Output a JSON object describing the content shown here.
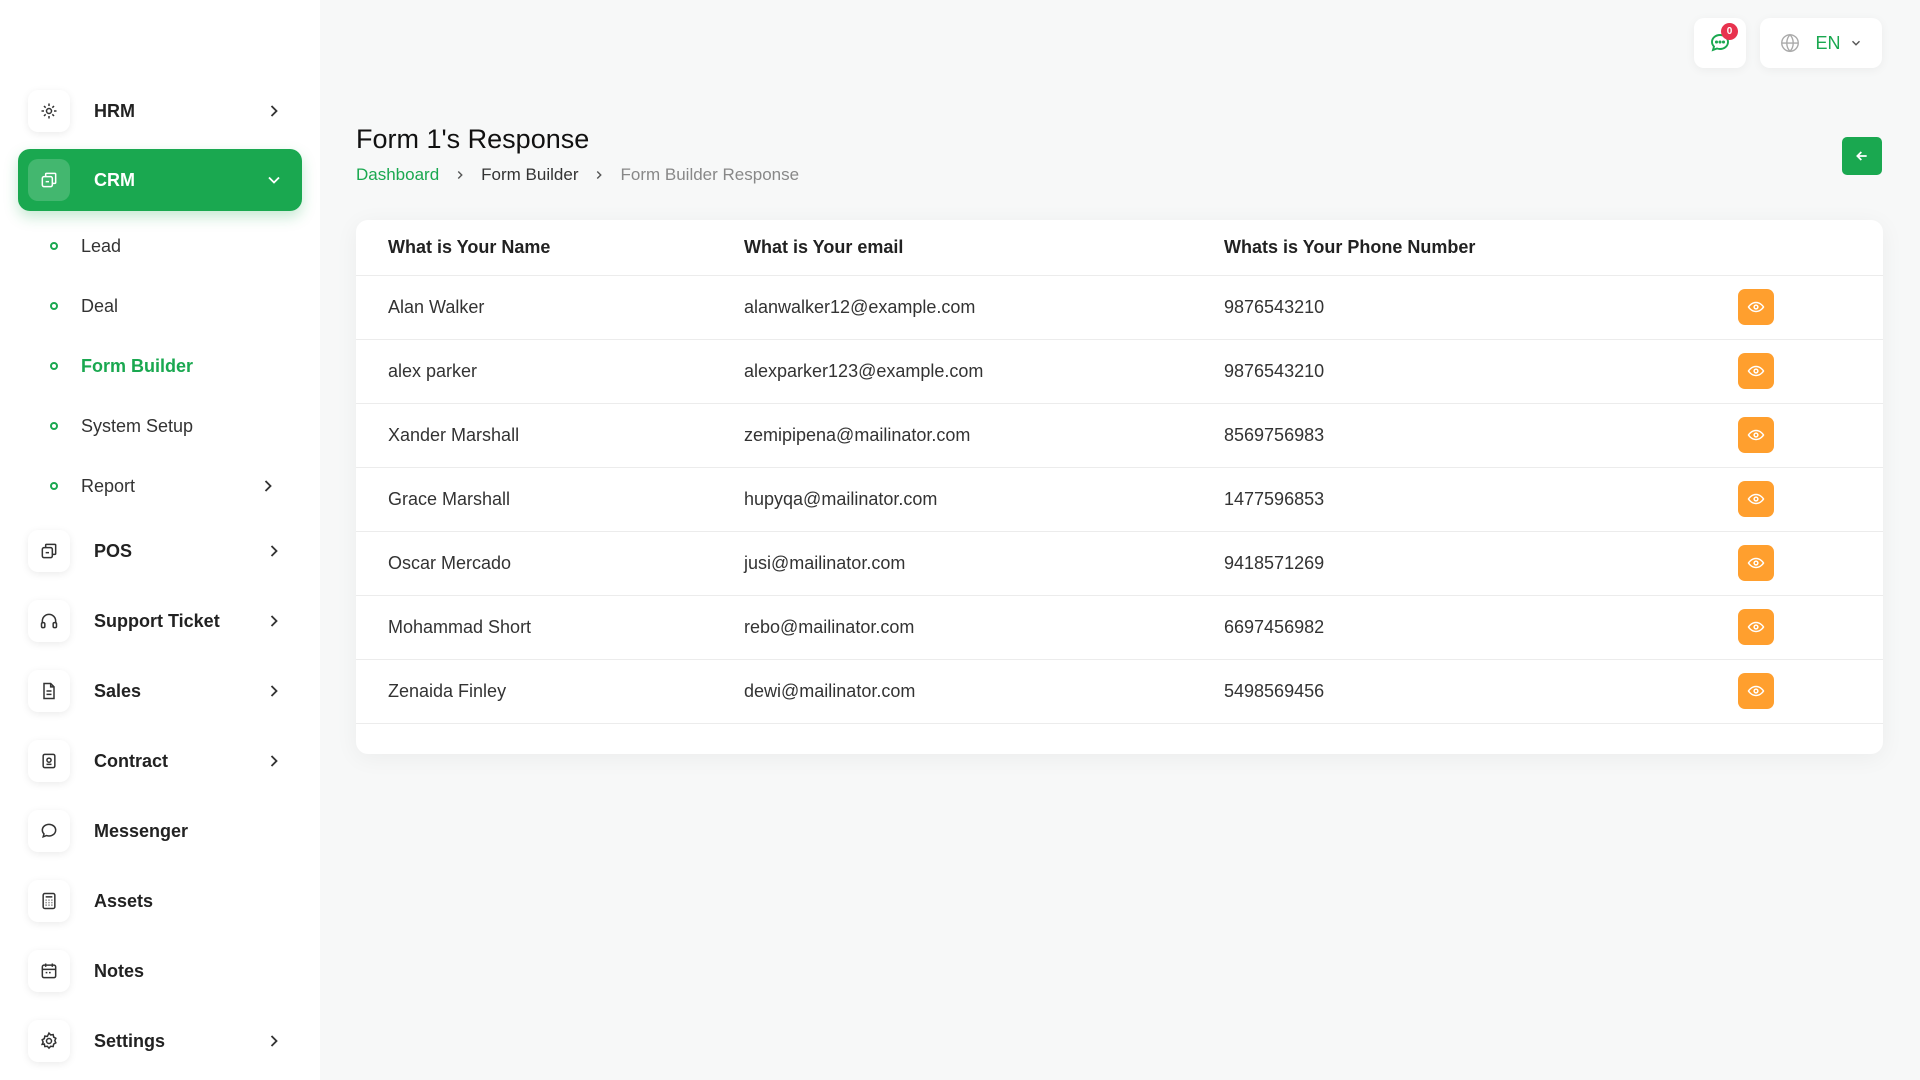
{
  "sidebar": {
    "items": [
      {
        "name": "hrm",
        "label": "HRM",
        "icon": "hrm-icon"
      },
      {
        "name": "crm",
        "label": "CRM",
        "icon": "crm-icon"
      },
      {
        "name": "pos",
        "label": "POS",
        "icon": "pos-icon"
      },
      {
        "name": "support-ticket",
        "label": "Support Ticket",
        "icon": "headset-icon"
      },
      {
        "name": "sales",
        "label": "Sales",
        "icon": "document-icon"
      },
      {
        "name": "contract",
        "label": "Contract",
        "icon": "contract-icon"
      },
      {
        "name": "messenger",
        "label": "Messenger",
        "icon": "chat-icon"
      },
      {
        "name": "assets",
        "label": "Assets",
        "icon": "calculator-icon"
      },
      {
        "name": "notes",
        "label": "Notes",
        "icon": "calendar-icon"
      },
      {
        "name": "settings",
        "label": "Settings",
        "icon": "gear-icon"
      }
    ],
    "crm_sub": [
      {
        "label": "Lead"
      },
      {
        "label": "Deal"
      },
      {
        "label": "Form Builder"
      },
      {
        "label": "System Setup"
      },
      {
        "label": "Report"
      }
    ]
  },
  "topbar": {
    "notification_count": "0",
    "language": "EN"
  },
  "page": {
    "title": "Form 1's Response",
    "breadcrumb": [
      "Dashboard",
      "Form Builder",
      "Form Builder Response"
    ]
  },
  "table": {
    "columns": [
      "What is Your Name",
      "What is Your email",
      "Whats is Your Phone Number"
    ],
    "rows": [
      {
        "name": "Alan Walker",
        "email": "alanwalker12@example.com",
        "phone": "9876543210"
      },
      {
        "name": "alex parker",
        "email": "alexparker123@example.com",
        "phone": "9876543210"
      },
      {
        "name": "Xander Marshall",
        "email": "zemipipena@mailinator.com",
        "phone": "8569756983"
      },
      {
        "name": "Grace Marshall",
        "email": "hupyqa@mailinator.com",
        "phone": "1477596853"
      },
      {
        "name": "Oscar Mercado",
        "email": "jusi@mailinator.com",
        "phone": "9418571269"
      },
      {
        "name": "Mohammad Short",
        "email": "rebo@mailinator.com",
        "phone": "6697456982"
      },
      {
        "name": "Zenaida Finley",
        "email": "dewi@mailinator.com",
        "phone": "5498569456"
      }
    ]
  },
  "colors": {
    "accent": "#1aa850",
    "view_button": "#ff9f2e",
    "badge": "#e8324e"
  }
}
